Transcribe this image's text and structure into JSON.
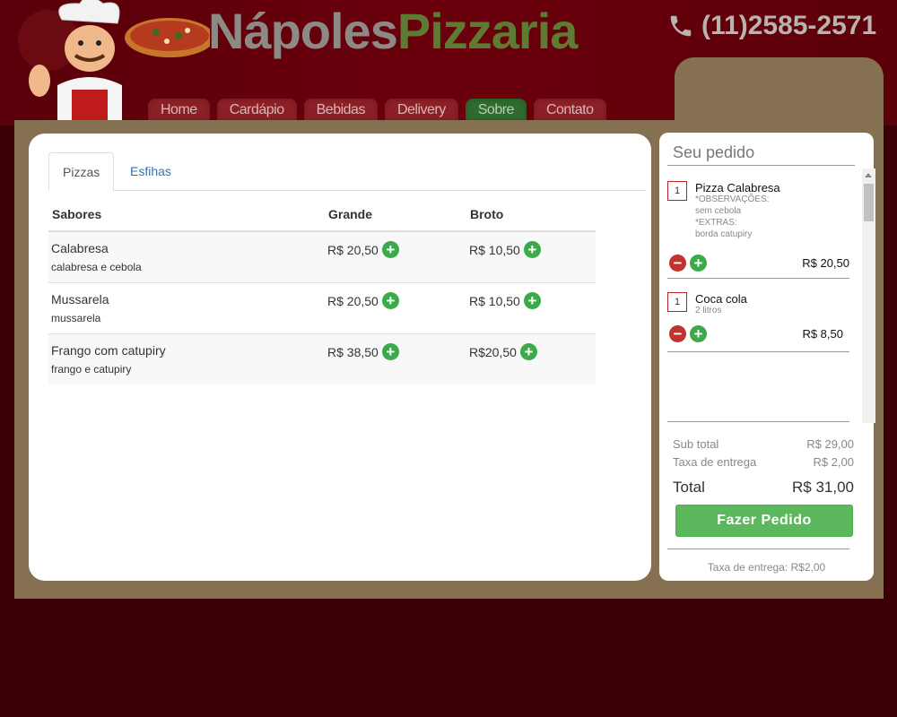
{
  "header": {
    "brand_part1": "Nápoles",
    "brand_part2": "Pizzaria",
    "phone": "(11)2585-2571",
    "phone_icon": "phone-icon",
    "nav": [
      {
        "label": "Home",
        "active": false
      },
      {
        "label": "Cardápio",
        "active": false
      },
      {
        "label": "Bebidas",
        "active": false
      },
      {
        "label": "Delivery",
        "active": false
      },
      {
        "label": "Sobre",
        "active": true
      },
      {
        "label": "Contato",
        "active": false
      }
    ]
  },
  "menu": {
    "tabs": [
      {
        "label": "Pizzas",
        "active": true
      },
      {
        "label": "Esfihas",
        "active": false
      }
    ],
    "columns": [
      "Sabores",
      "Grande",
      "Broto"
    ],
    "rows": [
      {
        "flavor": "Calabresa",
        "description": "calabresa e cebola",
        "grande": "R$ 20,50",
        "broto": "R$ 10,50"
      },
      {
        "flavor": "Mussarela",
        "description": "mussarela",
        "grande": "R$ 20,50",
        "broto": "R$ 10,50"
      },
      {
        "flavor": "Frango com catupiry",
        "description": "frango e catupiry",
        "grande": "R$ 38,50",
        "broto": "R$20,50"
      }
    ]
  },
  "order": {
    "title": "Seu pedido",
    "items": [
      {
        "qty": "1",
        "name": "Pizza Calabresa",
        "notes": [
          "*OBSERVAÇÕES:",
          "sem cebola",
          "*EXTRAS:",
          "borda catupiry"
        ],
        "price": "R$ 20,50"
      },
      {
        "qty": "1",
        "name": "Coca cola",
        "notes": [
          "2 litros"
        ],
        "price": "R$ 8,50"
      }
    ],
    "subtotal_label": "Sub total",
    "subtotal_value": "R$ 29,00",
    "delivery_label": "Taxa de entrega",
    "delivery_value": "R$ 2,00",
    "total_label": "Total",
    "total_value": "R$ 31,00",
    "cta_label": "Fazer Pedido",
    "fee_note": "Taxa de entrega: R$2,00"
  },
  "colors": {
    "background": "#3a0005",
    "header": "#5c0009",
    "frame": "#857152",
    "nav": "#8c2026",
    "nav_active": "#2f6b2e",
    "brand_gray": "#8d8a86",
    "brand_green": "#5f7b33",
    "add": "#3ca94a",
    "remove": "#c0332f",
    "cta": "#5cb85c"
  }
}
